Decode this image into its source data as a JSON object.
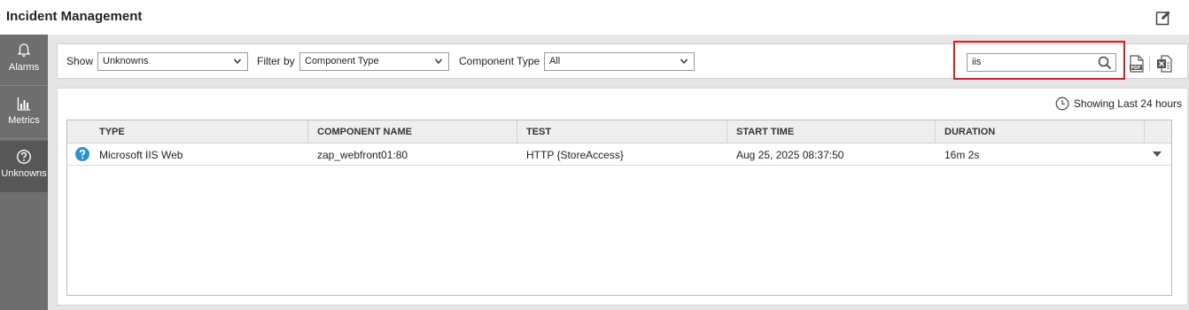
{
  "app": {
    "title": "Incident Management"
  },
  "sidebar": {
    "items": [
      {
        "label": "Alarms",
        "icon": "bell-icon",
        "active": false
      },
      {
        "label": "Metrics",
        "icon": "bar-chart-icon",
        "active": false
      },
      {
        "label": "Unknowns",
        "icon": "question-circle-icon",
        "active": true
      }
    ]
  },
  "filters": {
    "show_label": "Show",
    "show_value": "Unknowns",
    "filter_by_label": "Filter by",
    "filter_by_value": "Component Type",
    "component_type_label": "Component Type",
    "component_type_value": "All",
    "search_value": "iis"
  },
  "status": {
    "showing_text": "Showing Last 24 hours"
  },
  "table": {
    "columns": [
      "TYPE",
      "COMPONENT NAME",
      "TEST",
      "START TIME",
      "DURATION"
    ],
    "rows": [
      {
        "type": "Microsoft IIS Web",
        "component_name": "zap_webfront01:80",
        "test": "HTTP {StoreAccess}",
        "start_time": "Aug 25, 2025 08:37:50",
        "duration": "16m 2s",
        "status_icon": "question-icon"
      }
    ]
  },
  "colors": {
    "sidebar_bg": "#6e6e6e",
    "sidebar_active_bg": "#575757",
    "search_highlight": "#d11f1f",
    "unknown_icon": "#2e8fd0"
  }
}
